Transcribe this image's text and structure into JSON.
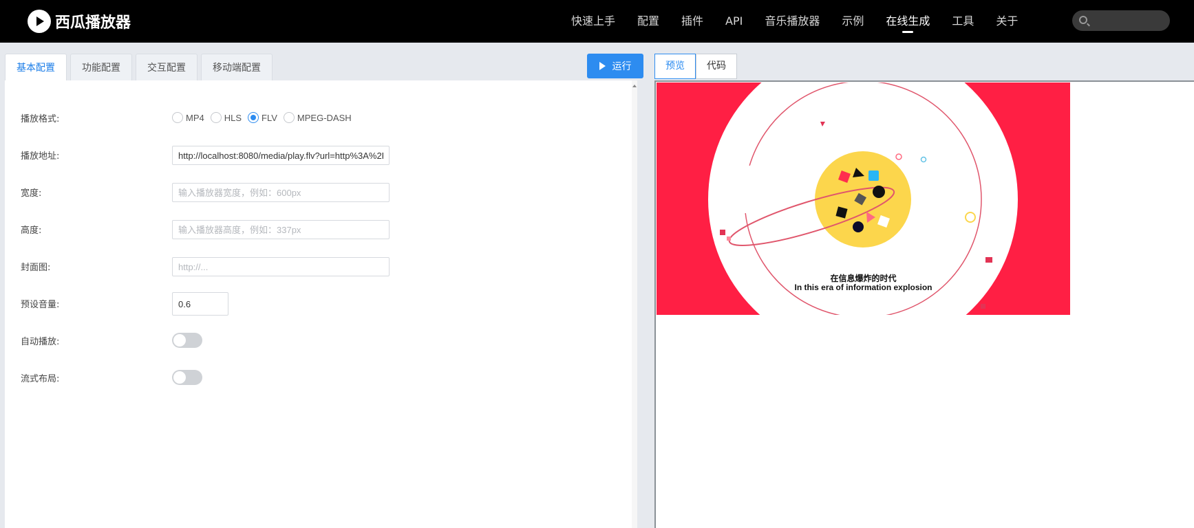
{
  "brand": {
    "name": "西瓜播放器"
  },
  "nav": {
    "items": [
      {
        "label": "快速上手",
        "active": false
      },
      {
        "label": "配置",
        "active": false
      },
      {
        "label": "插件",
        "active": false
      },
      {
        "label": "API",
        "active": false
      },
      {
        "label": "音乐播放器",
        "active": false
      },
      {
        "label": "示例",
        "active": false
      },
      {
        "label": "在线生成",
        "active": true
      },
      {
        "label": "工具",
        "active": false
      },
      {
        "label": "关于",
        "active": false
      }
    ],
    "search": {
      "placeholder": ""
    }
  },
  "config_tabs": [
    "基本配置",
    "功能配置",
    "交互配置",
    "移动端配置"
  ],
  "run_button": {
    "label": "运行"
  },
  "form": {
    "format": {
      "label": "播放格式:",
      "options": [
        "MP4",
        "HLS",
        "FLV",
        "MPEG-DASH"
      ],
      "selected": "FLV"
    },
    "url": {
      "label": "播放地址:",
      "value": "http://localhost:8080/media/play.flv?url=http%3A%2F",
      "placeholder": ""
    },
    "width": {
      "label": "宽度:",
      "value": "",
      "placeholder": "输入播放器宽度，例如：600px"
    },
    "height": {
      "label": "高度:",
      "value": "",
      "placeholder": "输入播放器高度，例如：337px"
    },
    "poster": {
      "label": "封面图:",
      "value": "",
      "placeholder": "http://..."
    },
    "volume": {
      "label": "预设音量:",
      "value": "0.6"
    },
    "autoplay": {
      "label": "自动播放:",
      "on": false
    },
    "fluid": {
      "label": "流式布局:",
      "on": false
    }
  },
  "preview_tabs": [
    "预览",
    "代码"
  ],
  "preview_tab_selected": "预览",
  "video": {
    "caption_cn": "在信息爆炸的时代",
    "caption_en": "In this era of information explosion",
    "colors": {
      "background": "#ff1f44",
      "planet": "#fcd64c"
    }
  }
}
